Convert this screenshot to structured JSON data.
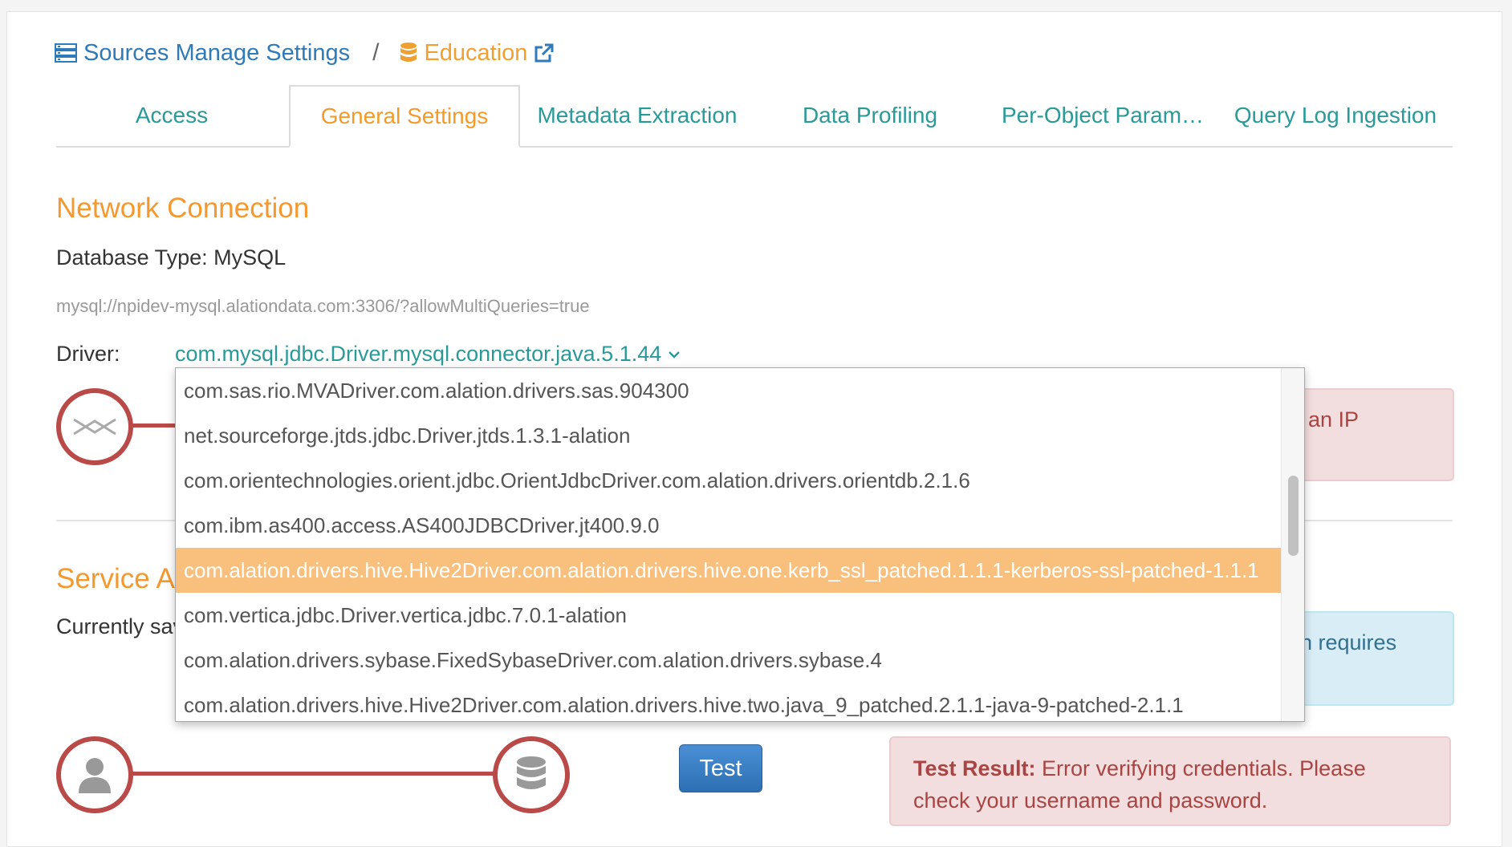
{
  "breadcrumb": {
    "sources_label": "Sources Manage Settings",
    "separator": "/",
    "current_label": "Education"
  },
  "tabs": [
    {
      "label": "Access",
      "active": false
    },
    {
      "label": "General Settings",
      "active": true
    },
    {
      "label": "Metadata Extraction",
      "active": false
    },
    {
      "label": "Data Profiling",
      "active": false
    },
    {
      "label": "Per-Object Param…",
      "active": false
    },
    {
      "label": "Query Log Ingestion",
      "active": false
    }
  ],
  "network": {
    "heading": "Network Connection",
    "db_type": "Database Type: MySQL",
    "url": "mysql://npidev-mysql.alationdata.com:3306/?allowMultiQueries=true",
    "driver_label": "Driver:",
    "driver_value": "com.mysql.jdbc.Driver.mysql.connector.java.5.1.44",
    "alert_partial": "an IP"
  },
  "service": {
    "heading": "Service Ac",
    "currently": "Currently sav",
    "alert_partial": "n requires"
  },
  "test": {
    "button_label": "Test",
    "result_label": "Test Result:",
    "result_message": "Error verifying credentials. Please check your username and password."
  },
  "driver_options": [
    "com.sas.rio.MVADriver.com.alation.drivers.sas.904300",
    "net.sourceforge.jtds.jdbc.Driver.jtds.1.3.1-alation",
    "com.orientechnologies.orient.jdbc.OrientJdbcDriver.com.alation.drivers.orientdb.2.1.6",
    "com.ibm.as400.access.AS400JDBCDriver.jt400.9.0",
    "com.alation.drivers.hive.Hive2Driver.com.alation.drivers.hive.one.kerb_ssl_patched.1.1.1-kerberos-ssl-patched-1.1.1",
    "com.vertica.jdbc.Driver.vertica.jdbc.7.0.1-alation",
    "com.alation.drivers.sybase.FixedSybaseDriver.com.alation.drivers.sybase.4",
    "com.alation.drivers.hive.Hive2Driver.com.alation.drivers.hive.two.java_9_patched.2.1.1-java-9-patched-2.1.1"
  ],
  "selected_option_index": 4,
  "colors": {
    "accent_orange": "#f5982e",
    "teal_link": "#2a9a98",
    "blue_link": "#2f7ab8",
    "danger": "#b94a48",
    "selected_row": "#f9c07d"
  }
}
